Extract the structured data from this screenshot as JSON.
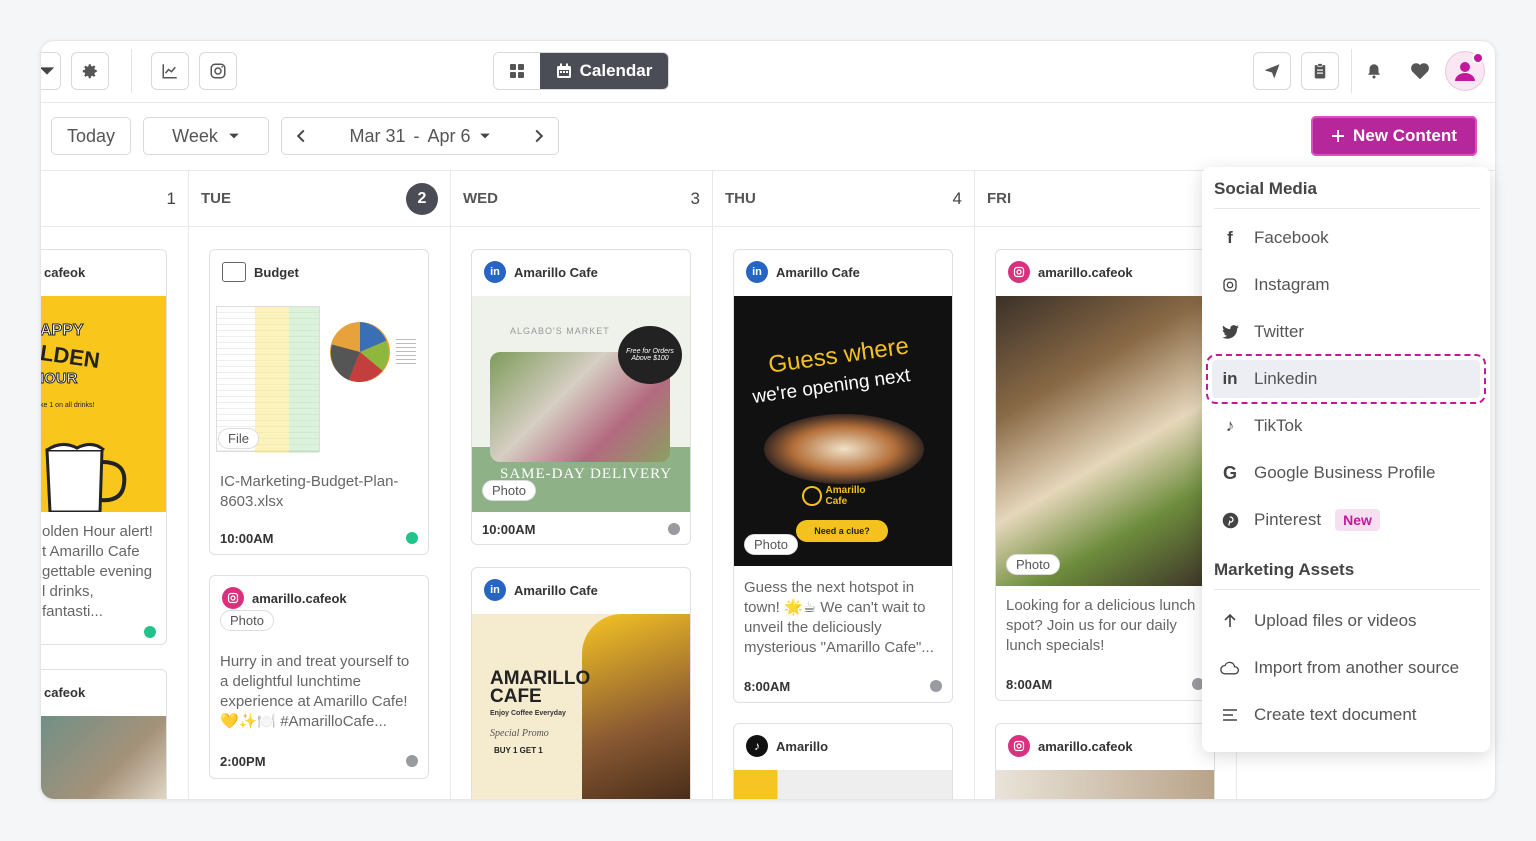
{
  "topbar": {
    "view_label": "Calendar"
  },
  "toolbar": {
    "today_label": "Today",
    "range_mode": "Week",
    "date_range_start": "Mar 31",
    "date_range_sep": "-",
    "date_range_end": "Apr 6",
    "new_content_label": "New Content"
  },
  "days": [
    {
      "name": "",
      "num": "1"
    },
    {
      "name": "TUE",
      "num": "2"
    },
    {
      "name": "WED",
      "num": "3"
    },
    {
      "name": "THU",
      "num": "4"
    },
    {
      "name": "FRI",
      "num": ""
    }
  ],
  "cards": {
    "mon1": {
      "account": "cafeok",
      "text": "olden Hour alert! t Amarillo Cafe gettable evening l drinks, fantasti...",
      "img_text1": "APPY",
      "img_text2": "LDEN",
      "img_text3": "IOUR",
      "img_text4": "ke 1 on all drinks!"
    },
    "mon2": {
      "account": "cafeok"
    },
    "tue1": {
      "account": "Budget",
      "tag": "File",
      "text": "IC-Marketing-Budget-Plan-8603.xlsx",
      "time": "10:00AM"
    },
    "tue2": {
      "account": "amarillo.cafeok",
      "tag": "Photo",
      "text": "Hurry in and treat yourself to a delightful lunchtime experience at Amarillo Cafe! 💛✨🍽️ #AmarilloCafe...",
      "time": "2:00PM"
    },
    "wed1": {
      "account": "Amarillo Cafe",
      "tag": "Photo",
      "time": "10:00AM",
      "img_brand": "ALGABO'S MARKET",
      "img_badge": "Free for Orders Above $100",
      "img_caption": "SAME-DAY DELIVERY"
    },
    "wed2": {
      "account": "Amarillo Cafe",
      "img_title1": "AMARILLO",
      "img_title2": "CAFE",
      "img_sub": "Enjoy Coffee Everyday",
      "img_promo": "Special Promo",
      "img_offer": "BUY 1 GET 1"
    },
    "thu1": {
      "account": "Amarillo Cafe",
      "tag": "Photo",
      "text": "Guess the next hotspot in town! 🌟☕ We can't wait to unveil the deliciously mysterious \"Amarillo Cafe\"...",
      "time": "8:00AM",
      "img_headline1": "Guess where",
      "img_headline2": "we're opening next",
      "img_brand": "Amarillo Cafe",
      "img_cta": "Need a clue?"
    },
    "thu2": {
      "account": "Amarillo"
    },
    "fri1": {
      "account": "amarillo.cafeok",
      "tag": "Photo",
      "text": "Looking for a delicious lunch spot? Join us for our daily lunch specials!",
      "time": "8:00AM"
    },
    "fri2": {
      "account": "amarillo.cafeok"
    }
  },
  "menu": {
    "social_title": "Social Media",
    "items": [
      "Facebook",
      "Instagram",
      "Twitter",
      "Linkedin",
      "TikTok",
      "Google Business Profile",
      "Pinterest"
    ],
    "pinterest_badge": "New",
    "assets_title": "Marketing Assets",
    "asset_items": [
      "Upload files or videos",
      "Import from another source",
      "Create text document"
    ]
  },
  "colors": {
    "accent": "#b5279b",
    "status_green": "#21c38a",
    "status_grey": "#9a9ba0"
  }
}
